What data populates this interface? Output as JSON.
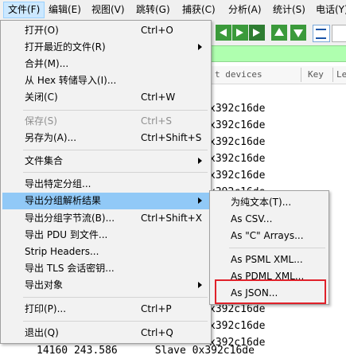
{
  "menubar": {
    "items": [
      {
        "label": "文件(F)"
      },
      {
        "label": "编辑(E)"
      },
      {
        "label": "视图(V)"
      },
      {
        "label": "跳转(G)"
      },
      {
        "label": "捕获(C)"
      },
      {
        "label": "分析(A)"
      },
      {
        "label": "统计(S)"
      },
      {
        "label": "电话(Y)"
      }
    ]
  },
  "background": {
    "display_filter_hint": "t devices",
    "column_key": "Key",
    "column_le": "Le",
    "packet_rows": [
      {
        "text": "x392c16de"
      },
      {
        "text": "x392c16de"
      },
      {
        "text": "x392c16de"
      },
      {
        "text": "x392c16de"
      },
      {
        "text": "x392c16de"
      },
      {
        "text": "x392c16de"
      },
      {
        "text": "x392c16de"
      },
      {
        "text": "x392c16de"
      },
      {
        "text": "x392c16de"
      },
      {
        "text": "x392c16de"
      },
      {
        "text": "x392c16de"
      },
      {
        "text": "x392c16de"
      },
      {
        "text": "x392c16de"
      },
      {
        "text": "x392c16de"
      },
      {
        "text": "x392c16de"
      },
      {
        "text": "14160 243.586      Slave 0x392c16de"
      }
    ]
  },
  "file_menu": {
    "items": [
      {
        "label": "打开(O)",
        "shortcut": "Ctrl+O",
        "submenu": false,
        "disabled": false
      },
      {
        "label": "打开最近的文件(R)",
        "shortcut": "",
        "submenu": true,
        "disabled": false
      },
      {
        "label": "合并(M)...",
        "shortcut": "",
        "submenu": false,
        "disabled": false
      },
      {
        "label": "从 Hex 转储导入(I)...",
        "shortcut": "",
        "submenu": false,
        "disabled": false
      },
      {
        "label": "关闭(C)",
        "shortcut": "Ctrl+W",
        "submenu": false,
        "disabled": false
      },
      {
        "label": "保存(S)",
        "shortcut": "Ctrl+S",
        "submenu": false,
        "disabled": true
      },
      {
        "label": "另存为(A)...",
        "shortcut": "Ctrl+Shift+S",
        "submenu": false,
        "disabled": false
      },
      {
        "label": "文件集合",
        "shortcut": "",
        "submenu": true,
        "disabled": false
      },
      {
        "label": "导出特定分组...",
        "shortcut": "",
        "submenu": false,
        "disabled": false
      },
      {
        "label": "导出分组解析结果",
        "shortcut": "",
        "submenu": true,
        "disabled": false,
        "highlighted": true
      },
      {
        "label": "导出分组字节流(B)...",
        "shortcut": "Ctrl+Shift+X",
        "submenu": false,
        "disabled": false
      },
      {
        "label": "导出 PDU 到文件...",
        "shortcut": "",
        "submenu": false,
        "disabled": false
      },
      {
        "label": "Strip Headers...",
        "shortcut": "",
        "submenu": false,
        "disabled": false
      },
      {
        "label": "导出 TLS 会话密钥...",
        "shortcut": "",
        "submenu": false,
        "disabled": false
      },
      {
        "label": "导出对象",
        "shortcut": "",
        "submenu": true,
        "disabled": false
      },
      {
        "label": "打印(P)...",
        "shortcut": "Ctrl+P",
        "submenu": false,
        "disabled": false
      },
      {
        "label": "退出(Q)",
        "shortcut": "Ctrl+Q",
        "submenu": false,
        "disabled": false
      }
    ]
  },
  "export_submenu": {
    "items": [
      {
        "label": "为纯文本(T)..."
      },
      {
        "label": "As CSV..."
      },
      {
        "label": "As \"C\" Arrays..."
      },
      {
        "label": "As PSML XML..."
      },
      {
        "label": "As PDML XML..."
      },
      {
        "label": "As JSON..."
      }
    ]
  },
  "colors": {
    "menu_highlight": "#91c9f7",
    "filter_bar": "#afffaf",
    "annotation_box": "#e0212a"
  }
}
